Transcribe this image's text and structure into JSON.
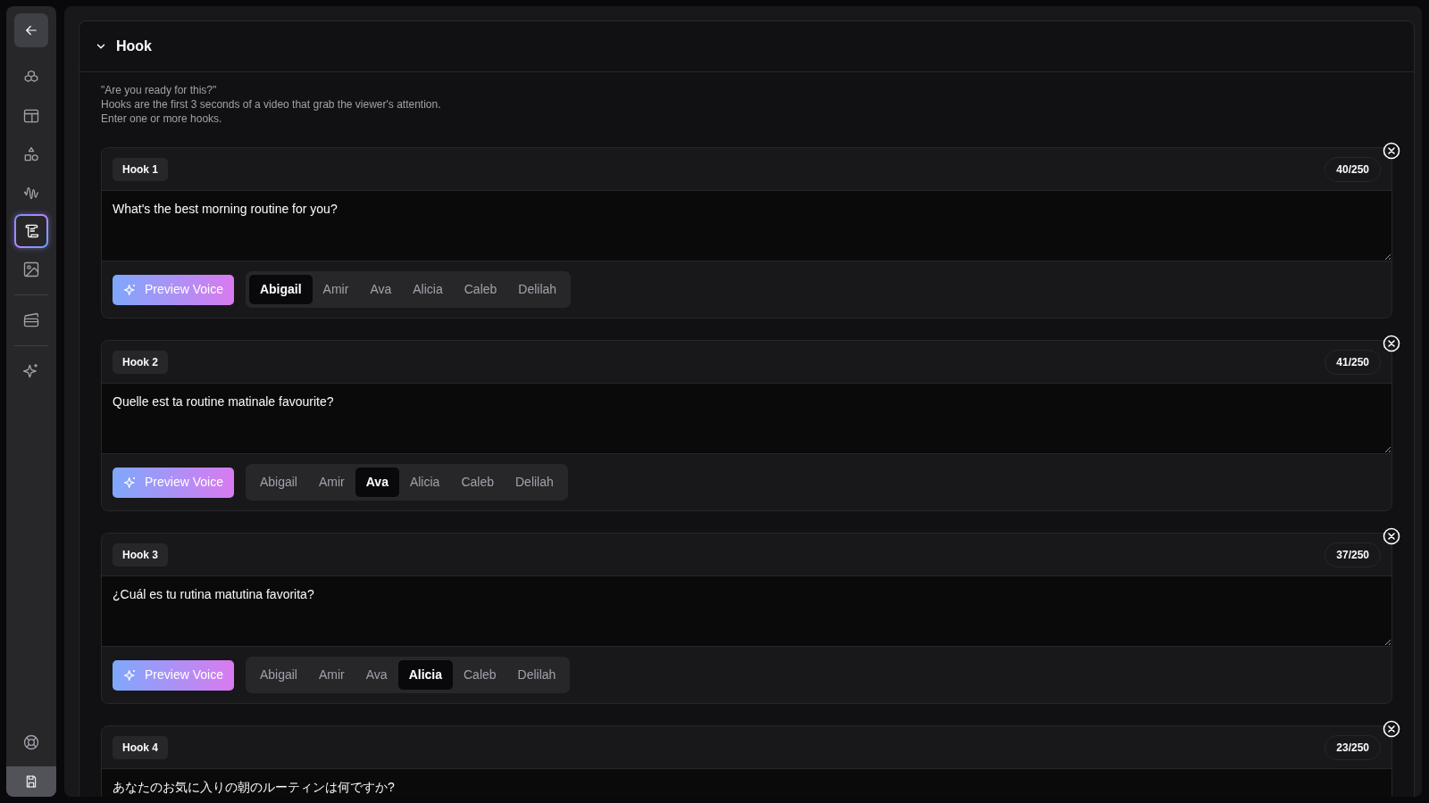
{
  "sidebar": {
    "items": [
      {
        "kind": "back",
        "selected": false
      },
      {
        "kind": "cubes",
        "selected": false
      },
      {
        "kind": "layout",
        "selected": false
      },
      {
        "kind": "shapes",
        "selected": false
      },
      {
        "kind": "wave",
        "selected": false
      },
      {
        "kind": "script",
        "selected": true
      },
      {
        "kind": "image",
        "selected": false
      },
      {
        "kind": "divider"
      },
      {
        "kind": "clapper",
        "selected": false
      },
      {
        "kind": "divider"
      },
      {
        "kind": "sparkles",
        "selected": false
      }
    ],
    "bottom": [
      {
        "kind": "lifebuoy"
      },
      {
        "kind": "save"
      }
    ]
  },
  "section": {
    "title": "Hook",
    "expanded": true,
    "description": [
      "\"Are you ready for this?\"",
      "Hooks are the first 3 seconds of a video that grab the viewer's attention.",
      "Enter one or more hooks."
    ],
    "hooks": [
      {
        "label": "Hook 1",
        "count": "40/250",
        "text": "What's the best morning routine for you?",
        "button": "Preview Voice",
        "voices": [
          {
            "name": "Abigail",
            "selected": true
          },
          {
            "name": "Amir",
            "selected": false
          },
          {
            "name": "Ava",
            "selected": false
          },
          {
            "name": "Alicia",
            "selected": false
          },
          {
            "name": "Caleb",
            "selected": false
          },
          {
            "name": "Delilah",
            "selected": false
          }
        ]
      },
      {
        "label": "Hook 2",
        "count": "41/250",
        "text": "Quelle est ta routine matinale favourite?",
        "button": "Preview Voice",
        "voices": [
          {
            "name": "Abigail",
            "selected": false
          },
          {
            "name": "Amir",
            "selected": false
          },
          {
            "name": "Ava",
            "selected": true
          },
          {
            "name": "Alicia",
            "selected": false
          },
          {
            "name": "Caleb",
            "selected": false
          },
          {
            "name": "Delilah",
            "selected": false
          }
        ]
      },
      {
        "label": "Hook 3",
        "count": "37/250",
        "text": "¿Cuál es tu rutina matutina favorita?",
        "button": "Preview Voice",
        "voices": [
          {
            "name": "Abigail",
            "selected": false
          },
          {
            "name": "Amir",
            "selected": false
          },
          {
            "name": "Ava",
            "selected": false
          },
          {
            "name": "Alicia",
            "selected": true
          },
          {
            "name": "Caleb",
            "selected": false
          },
          {
            "name": "Delilah",
            "selected": false
          }
        ]
      },
      {
        "label": "Hook 4",
        "count": "23/250",
        "text": "あなたのお気に入りの朝のルーティンは何ですか?"
      }
    ]
  }
}
